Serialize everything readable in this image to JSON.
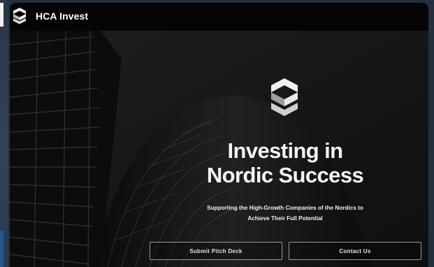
{
  "brand": {
    "name": "HCA Invest",
    "logo_icon": "hca-stacked-s-logo"
  },
  "hero": {
    "headline_line1": "Investing in",
    "headline_line2": "Nordic Success",
    "subtitle_line1": "Supporting the High-Growth Companies of the Nordics to",
    "subtitle_line2": "Achieve Their Full Potential",
    "background": "dark-building-facade-photo"
  },
  "actions": {
    "submit_label": "Submit Pitch Deck",
    "contact_label": "Contact Us"
  },
  "colors": {
    "topbar": "#050505",
    "hero_bg": "#1d1d1d",
    "text": "#f4f4f4",
    "button_border": "#9a9a9a"
  }
}
